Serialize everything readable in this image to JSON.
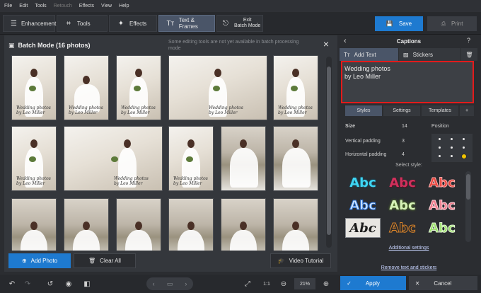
{
  "menu": [
    "File",
    "Edit",
    "Tools",
    "Retouch",
    "Effects",
    "View",
    "Help"
  ],
  "toolbar": {
    "enhancement": "Enhancement",
    "tools": "Tools",
    "effects": "Effects",
    "text_frames": "Text & Frames",
    "exit_batch_1": "Exit",
    "exit_batch_2": "Batch Mode",
    "save": "Save",
    "print": "Print"
  },
  "batch": {
    "title": "Batch Mode (16 photos)",
    "note": "Some editing tools are not yet available in batch processing mode",
    "caption_line1": "Wedding photos",
    "caption_line2": "by Leo Miller",
    "add_photo": "Add Photo",
    "clear_all": "Clear All",
    "video_tutorial": "Video Tutorial"
  },
  "captions": {
    "title": "Captions",
    "tab_add_text": "Add Text",
    "tab_stickers": "Stickers",
    "text_value": "Wedding photos\nby Leo Miller",
    "subtabs": [
      "Styles",
      "Settings",
      "Templates",
      "+"
    ],
    "size_label": "Size",
    "size_value": "14",
    "position_label": "Position",
    "vpad_label": "Vertical padding",
    "vpad_value": "3",
    "hpad_label": "Horizontal padding",
    "hpad_value": "4",
    "select_style": "Select style:",
    "style_sample": "Abc",
    "additional_settings": "Additional settings",
    "remove_text": "Remove text and stickers"
  },
  "bottom": {
    "one_to_one": "1:1",
    "zoom": "21%",
    "apply": "Apply",
    "cancel": "Cancel"
  },
  "colors": {
    "accent_blue": "#1e7ad0",
    "highlight_red": "#e31b1b",
    "position_selected": "#f2c400"
  }
}
